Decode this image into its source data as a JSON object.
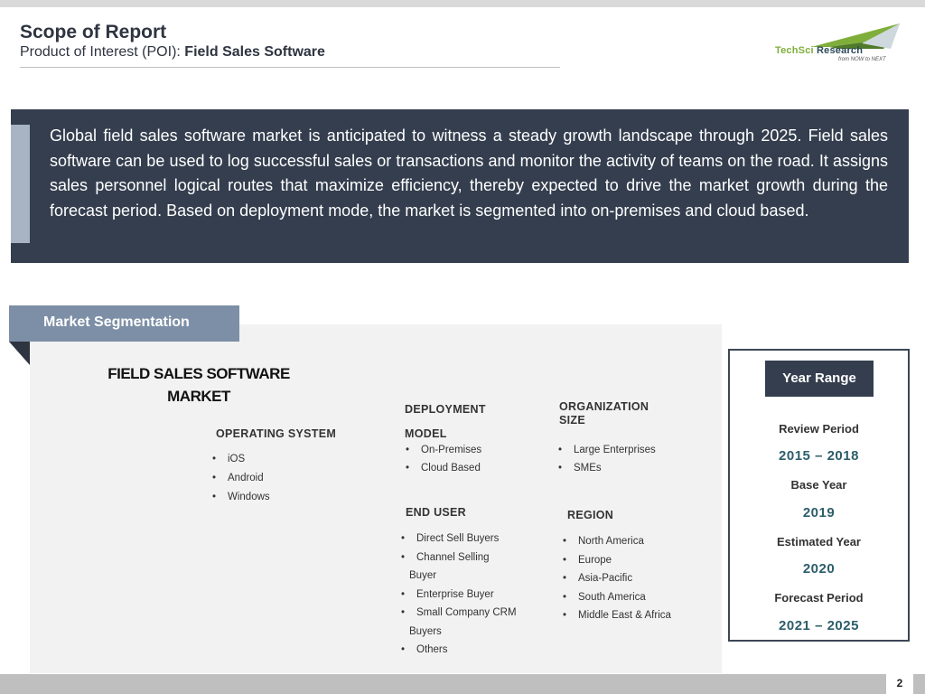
{
  "header": {
    "title": "Scope of Report",
    "subtitle_prefix": "Product of Interest (POI): ",
    "subtitle_product": "Field Sales Software"
  },
  "logo": {
    "name_part1": "TechSci ",
    "name_part2": "Research",
    "tagline": "from NOW to NEXT"
  },
  "intro": {
    "text": "Global field sales software market is anticipated to witness a steady growth landscape through 2025. Field sales software can be used to log successful sales or transactions and monitor the activity of teams on the road. It assigns sales personnel logical routes that maximize efficiency, thereby expected to drive the market growth during the forecast period. Based on deployment mode, the market is segmented into on-premises and cloud based."
  },
  "segmentation": {
    "header": "Market Segmentation",
    "market_title_line1": "FIELD SALES SOFTWARE",
    "market_title_line2": "MARKET",
    "operating_system": {
      "label": "OPERATING SYSTEM",
      "items": [
        "iOS",
        "Android",
        "Windows"
      ]
    },
    "deployment_model": {
      "label_line1": "DEPLOYMENT",
      "label_line2": "MODEL",
      "items": [
        "On-Premises",
        "Cloud Based"
      ]
    },
    "organization_size": {
      "label_line1": "ORGANIZATION",
      "label_line2": "SIZE",
      "items": [
        "Large Enterprises",
        "SMEs"
      ]
    },
    "end_user": {
      "label": "END USER",
      "items": [
        "Direct Sell Buyers",
        "Channel Selling",
        "Buyer",
        "Enterprise Buyer",
        "Small Company CRM",
        "Buyers",
        "Others"
      ]
    },
    "region": {
      "label": "REGION",
      "items": [
        "North America",
        "Europe",
        "Asia-Pacific",
        "South America",
        "Middle East & Africa"
      ]
    }
  },
  "year_range": {
    "header": "Year Range",
    "review_label": "Review Period",
    "review_value": "2015 – 2018",
    "base_label": "Base Year",
    "base_value": "2019",
    "estimated_label": "Estimated Year",
    "estimated_value": "2020",
    "forecast_label": "Forecast Period",
    "forecast_value": "2021 – 2025"
  },
  "footer": {
    "page_number": "2"
  },
  "colors": {
    "dark_slate": "#343e4e",
    "segment_blue": "#7d8fa6",
    "year_value": "#2c5e6a",
    "logo_green": "#7fae3a"
  }
}
